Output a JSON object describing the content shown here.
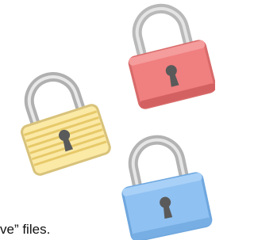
{
  "illustration": {
    "icons": [
      {
        "name": "red-padlock-icon",
        "color": "#f07f7f"
      },
      {
        "name": "yellow-padlock-icon",
        "color": "#fbe9a6"
      },
      {
        "name": "blue-padlock-icon",
        "color": "#8fc1f2"
      }
    ],
    "shackle_color": "#a8a8a8",
    "keyhole_color": "#5a5a5a"
  },
  "caption": {
    "text": "ve” files."
  }
}
